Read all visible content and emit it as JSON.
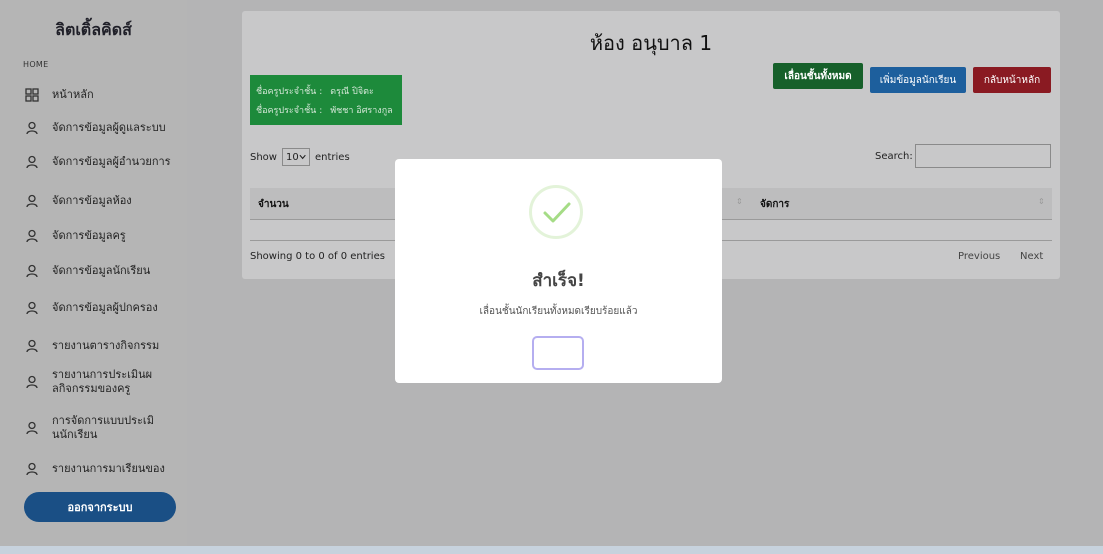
{
  "sidebar": {
    "brand": "ลิตเติ้ลคิดส์",
    "section_header": "HOME",
    "items": [
      {
        "label": "หน้าหลัก",
        "icon": "dashboard-icon"
      },
      {
        "label": "จัดการข้อมูลผู้ดูแลระบบ",
        "icon": "user-icon"
      },
      {
        "label": "จัดการข้อมูลผู้อำนวยการ",
        "icon": "user-icon"
      },
      {
        "label": "จัดการข้อมูลห้อง",
        "icon": "user-icon"
      },
      {
        "label": "จัดการข้อมูลครู",
        "icon": "user-icon"
      },
      {
        "label": "จัดการข้อมูลนักเรียน",
        "icon": "user-icon"
      },
      {
        "label": "จัดการข้อมูลผู้ปกครอง",
        "icon": "user-icon"
      },
      {
        "label": "รายงานตารางกิจกรรม",
        "icon": "user-icon"
      },
      {
        "label": "รายงานการประเมินผลกิจกรรมของครู",
        "icon": "user-icon"
      },
      {
        "label": "การจัดการแบบประเมินนักเรียน",
        "icon": "user-icon"
      },
      {
        "label": "รายงานการมาเรียนของ",
        "icon": "user-icon"
      }
    ],
    "logout_label": "ออกจากระบบ"
  },
  "main": {
    "title": "ห้อง อนุบาล 1",
    "buttons": {
      "promote": "เลื่อนชั้นทั้งหมด",
      "add_student": "เพิ่มข้อมูลนักเรียน",
      "back_home": "กลับหน้าหลัก"
    },
    "teachers": [
      {
        "label": "ชื่อครูประจำชั้น :",
        "name": "ดรุณี ปิจิตะ"
      },
      {
        "label": "ชื่อครูประจำชั้น :",
        "name": "พัชชา อิศรางกูล"
      }
    ],
    "show_label": "Show",
    "entries_value": "10",
    "entries_label": "entries",
    "search_label": "Search:",
    "table": {
      "columns": [
        "จำนวน",
        "จัดการ"
      ]
    },
    "info": "Showing 0 to 0 of 0 entries",
    "pagination": {
      "previous": "Previous",
      "next": "Next"
    }
  },
  "modal": {
    "title": "สำเร็จ!",
    "message": "เลื่อนชั้นนักเรียนทั้งหมดเรียบร้อยแล้ว",
    "ok_label": "",
    "icon": "check-icon",
    "accent_color": "#a5dc86"
  }
}
